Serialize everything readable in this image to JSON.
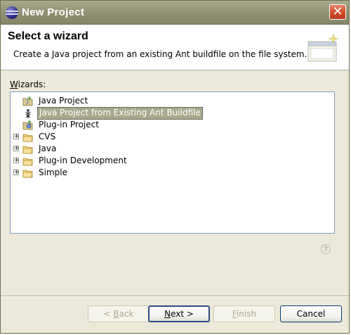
{
  "window": {
    "title": "New Project",
    "close_label": "✕"
  },
  "header": {
    "title": "Select a wizard",
    "description": "Create a Java project from an existing Ant buildfile on the file system."
  },
  "wizards": {
    "label_prefix": "",
    "label_mnemonic": "W",
    "label_rest": "izards:",
    "items": [
      {
        "label": "Java Project",
        "icon": "java-project-icon",
        "expandable": false,
        "selected": false
      },
      {
        "label": "Java Project from Existing Ant Buildfile",
        "icon": "ant-icon",
        "expandable": false,
        "selected": true
      },
      {
        "label": "Plug-in Project",
        "icon": "plugin-project-icon",
        "expandable": false,
        "selected": false
      },
      {
        "label": "CVS",
        "icon": "folder-icon",
        "expandable": true,
        "selected": false
      },
      {
        "label": "Java",
        "icon": "folder-icon",
        "expandable": true,
        "selected": false
      },
      {
        "label": "Plug-in Development",
        "icon": "folder-icon",
        "expandable": true,
        "selected": false
      },
      {
        "label": "Simple",
        "icon": "folder-icon",
        "expandable": true,
        "selected": false
      }
    ]
  },
  "help_label": "?",
  "buttons": {
    "back": {
      "prefix": "< ",
      "mnemonic": "B",
      "rest": "ack"
    },
    "next": {
      "prefix": "",
      "mnemonic": "N",
      "rest": "ext >"
    },
    "finish": {
      "prefix": "",
      "mnemonic": "F",
      "rest": "inish"
    },
    "cancel": {
      "label": "Cancel"
    }
  }
}
